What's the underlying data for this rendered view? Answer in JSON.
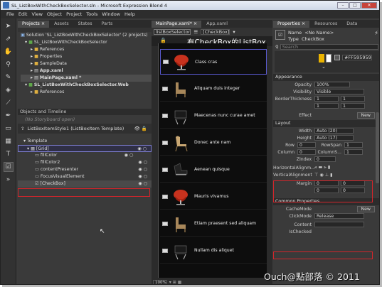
{
  "window": {
    "title": "SL_ListBoxWithCheckBoxSelector.sln - Microsoft Expression Blend 4"
  },
  "menu": [
    "File",
    "Edit",
    "View",
    "Object",
    "Project",
    "Tools",
    "Window",
    "Help"
  ],
  "projects_panel": {
    "tabs": [
      "Projects ×",
      "Assets",
      "States",
      "Parts"
    ],
    "items": [
      "Solution 'SL_ListBoxWithCheckBoxSelector' (2 projects)",
      "SL_ListBoxWithCheckBoxSelector",
      "References",
      "Properties",
      "SampleData",
      "App.xaml",
      "MainPage.xaml *",
      "SL_ListBoxWithCheckBoxSelector.Web",
      "References"
    ]
  },
  "objects_panel": {
    "title": "Objects and Timeline",
    "storyboard": "(No Storyboard open)",
    "template_name": "ListBoxItemStyle1 (ListBoxItem Template)",
    "items": [
      "Template",
      "[Grid]",
      "fillColor",
      "fillColor2",
      "contentPresenter",
      "FocusVisualElement",
      "[CheckBox]"
    ]
  },
  "doc": {
    "tabs": [
      "MainPage.xaml* ×",
      "App.xaml"
    ],
    "breadcrumb_root": "listBoxSelector",
    "breadcrumb_item": "[CheckBox]",
    "heading": "有CheckBox的ListBox",
    "zoom": "100%",
    "items": [
      "Class cras",
      "Aliquam duis integer",
      "Maecenas nunc curae amet",
      "Donec ante nam",
      "Aenean quisque",
      "Mauris vivamus",
      "Etiam praesent sed aliquam",
      "Nullam dis aliquet"
    ]
  },
  "properties": {
    "tabs": [
      "Properties ×",
      "Resources",
      "Data"
    ],
    "name_label": "Name",
    "name_value": "<No Name>",
    "type_label": "Type",
    "type_value": "CheckBox",
    "search_placeholder": "Search",
    "color_hex": "#FF595959",
    "appearance": {
      "title": "Appearance",
      "opacity_label": "Opacity",
      "opacity": "100%",
      "visibility_label": "Visibility",
      "visibility": "Visible",
      "border_label": "BorderThickness",
      "border_vals": [
        "1",
        "1",
        "1",
        "1"
      ],
      "effect_label": "Effect",
      "new_label": "New"
    },
    "layout": {
      "title": "Layout",
      "width_label": "Width",
      "width": "Auto (20)",
      "height_label": "Height",
      "height": "Auto (17)",
      "row_label": "Row",
      "row": "0",
      "rowspan_label": "RowSpan",
      "rowspan": "1",
      "column_label": "Column",
      "column": "0",
      "colspan_label": "ColumnS...",
      "colspan": "1",
      "zindex_label": "ZIndex",
      "zindex": "0",
      "halign_label": "HorizontalAlignm...",
      "valign_label": "VerticalAlignment",
      "margin_label": "Margin",
      "margin_vals": [
        "0",
        "0",
        "0",
        "0"
      ]
    },
    "common": {
      "title": "Common Properties",
      "cachemode_label": "CacheMode",
      "cachemode_new": "New",
      "clickmode_label": "ClickMode",
      "clickmode": "Release",
      "content_label": "Content",
      "content": "",
      "ischecked_label": "IsChecked"
    }
  },
  "watermark": "Ouch@點部落 © 2011",
  "colors": {
    "accent": "#d4252b",
    "chair_red": "#c8321e",
    "chair_tan": "#a8875a"
  }
}
